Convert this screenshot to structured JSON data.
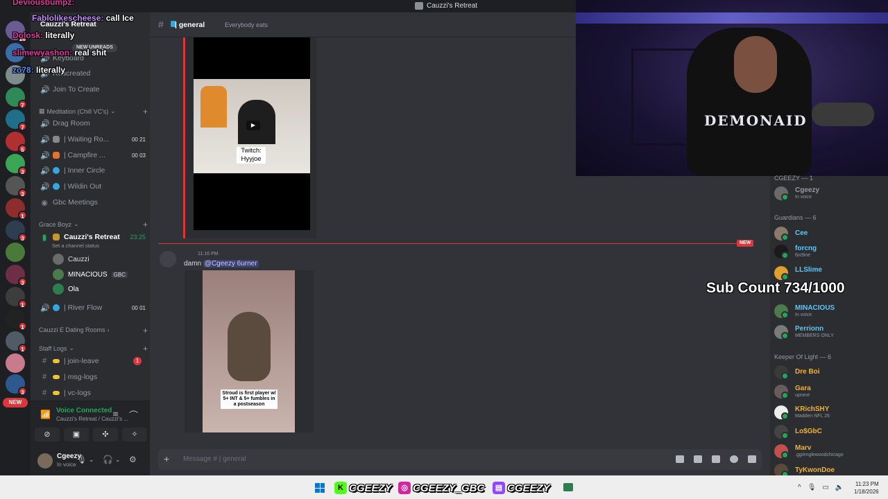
{
  "window": {
    "title": "Cauzzi's Retreat"
  },
  "overlay_chat": [
    {
      "user": "Deviousbumpz:",
      "text": ""
    },
    {
      "user": "Fablolikescheese:",
      "text": "call Ice"
    },
    {
      "user": "Dolosk:",
      "text": "literally"
    },
    {
      "user": "slimewyashon:",
      "text": "real shit"
    },
    {
      "user": "zo78:",
      "text": "literally"
    }
  ],
  "server_header": {
    "name": "Cauzzi's Retreat",
    "new_unreads": "NEW UNREADS"
  },
  "server_rail": {
    "new_label": "NEW",
    "badges": [
      "26",
      "7",
      "7",
      "5",
      "3",
      "3",
      "1",
      "3",
      "3",
      "1",
      "1",
      "1",
      "3"
    ]
  },
  "sidebar": {
    "top_channels": [
      {
        "label": "Keyboard"
      },
      {
        "label": "Reacreated"
      },
      {
        "label": "Join To Create"
      }
    ],
    "categories": {
      "meditation": "Meditation (Chill VC's)",
      "grace_boyz": "Grace Boyz",
      "dating_rooms": "Cauzzi E Dating Rooms",
      "staff_logs": "Staff Logs"
    },
    "meditation_channels": [
      {
        "label": "Drag Room",
        "count": ""
      },
      {
        "label": "| Waiting Ro...",
        "count": "00 21"
      },
      {
        "label": "| Campfire ...",
        "count": "00 03"
      },
      {
        "label": "| Inner Circle",
        "count": ""
      },
      {
        "label": "| Wildin Out",
        "count": ""
      },
      {
        "label": "Gbc Meetings",
        "count": ""
      }
    ],
    "active_channel": {
      "label": "Cauzzi's Retreat",
      "timer": "23:25",
      "status": "Set a channel status"
    },
    "voice_users": [
      {
        "name": "Cauzzi",
        "tag": ""
      },
      {
        "name": "MINACIOUS",
        "tag": "GBC"
      },
      {
        "name": "Ola",
        "tag": ""
      }
    ],
    "river_flow": {
      "label": "| River Flow",
      "count": "00 01"
    },
    "staff_channels": [
      {
        "label": "| join-leave",
        "unread": "1"
      },
      {
        "label": "| msg-logs",
        "unread": ""
      },
      {
        "label": "| vc-logs",
        "unread": ""
      }
    ]
  },
  "voice_panel": {
    "status": "Voice Connected",
    "location": "Cauzzi's Retreat / Cauzzi's ..."
  },
  "user_panel": {
    "name": "Cgeezy",
    "status": "In voice"
  },
  "channel": {
    "name": "| general",
    "topic": "Everybody eats"
  },
  "messages": {
    "embed_caption": "Twitch:\nHyyjoe",
    "divider_label": "NEW",
    "time": "11:16 PM",
    "text": "damn",
    "mention": "@Cgeezy 6urner",
    "video_caption": "Stroud is first player w/ 5+ INT & 5+ fumbles in a postseason"
  },
  "composer": {
    "placeholder": "Message #",
    "channel": "| general"
  },
  "members": {
    "groups": [
      {
        "title": "CGEEZY — 1",
        "members": [
          {
            "name": "Cgeezy",
            "status": "In voice",
            "color": "#949ba4"
          }
        ]
      },
      {
        "title": "Guardians — 6",
        "members": [
          {
            "name": "Cee",
            "status": "",
            "color": "#5ac8fa"
          },
          {
            "name": "forcng",
            "status": "6ix9ine",
            "color": "#5ac8fa"
          },
          {
            "name": "LLSlime",
            "status": "",
            "color": "#5ac8fa"
          },
          {
            "name": "MINACIOUS",
            "status": "In voice",
            "color": "#5ac8fa"
          },
          {
            "name": "Perrionn",
            "status": "MEMBERS ONLY",
            "color": "#5ac8fa"
          }
        ]
      },
      {
        "title": "Keeper Of Light — 6",
        "members": [
          {
            "name": "Dre Boi",
            "status": "",
            "color": "#f0b232"
          },
          {
            "name": "Gara",
            "status": "upnext",
            "color": "#f0b232"
          },
          {
            "name": "KRichSHY",
            "status": "Madden NFL 26",
            "color": "#f0b232"
          },
          {
            "name": "Lo$GbC",
            "status": "",
            "color": "#f0b232"
          },
          {
            "name": "Marv",
            "status": ".gg/englewoodchicago",
            "color": "#f0b232"
          },
          {
            "name": "TyKwonDoe",
            "status": "",
            "color": "#f0b232"
          }
        ]
      }
    ]
  },
  "overlay": {
    "sub_count": "Sub Count 734/1000",
    "webcam_logo": "DEMONAID"
  },
  "taskbar": {
    "socials": [
      {
        "platform": "kick",
        "handle": "CGEEZY",
        "color": "#53fc18"
      },
      {
        "platform": "instagram",
        "handle": "CGEEZY_GBC",
        "color": "#d6249f"
      },
      {
        "platform": "twitch",
        "handle": "CGEEZY",
        "color": "#9146ff"
      }
    ],
    "time": "11:23 PM",
    "date": "1/18/2026"
  }
}
